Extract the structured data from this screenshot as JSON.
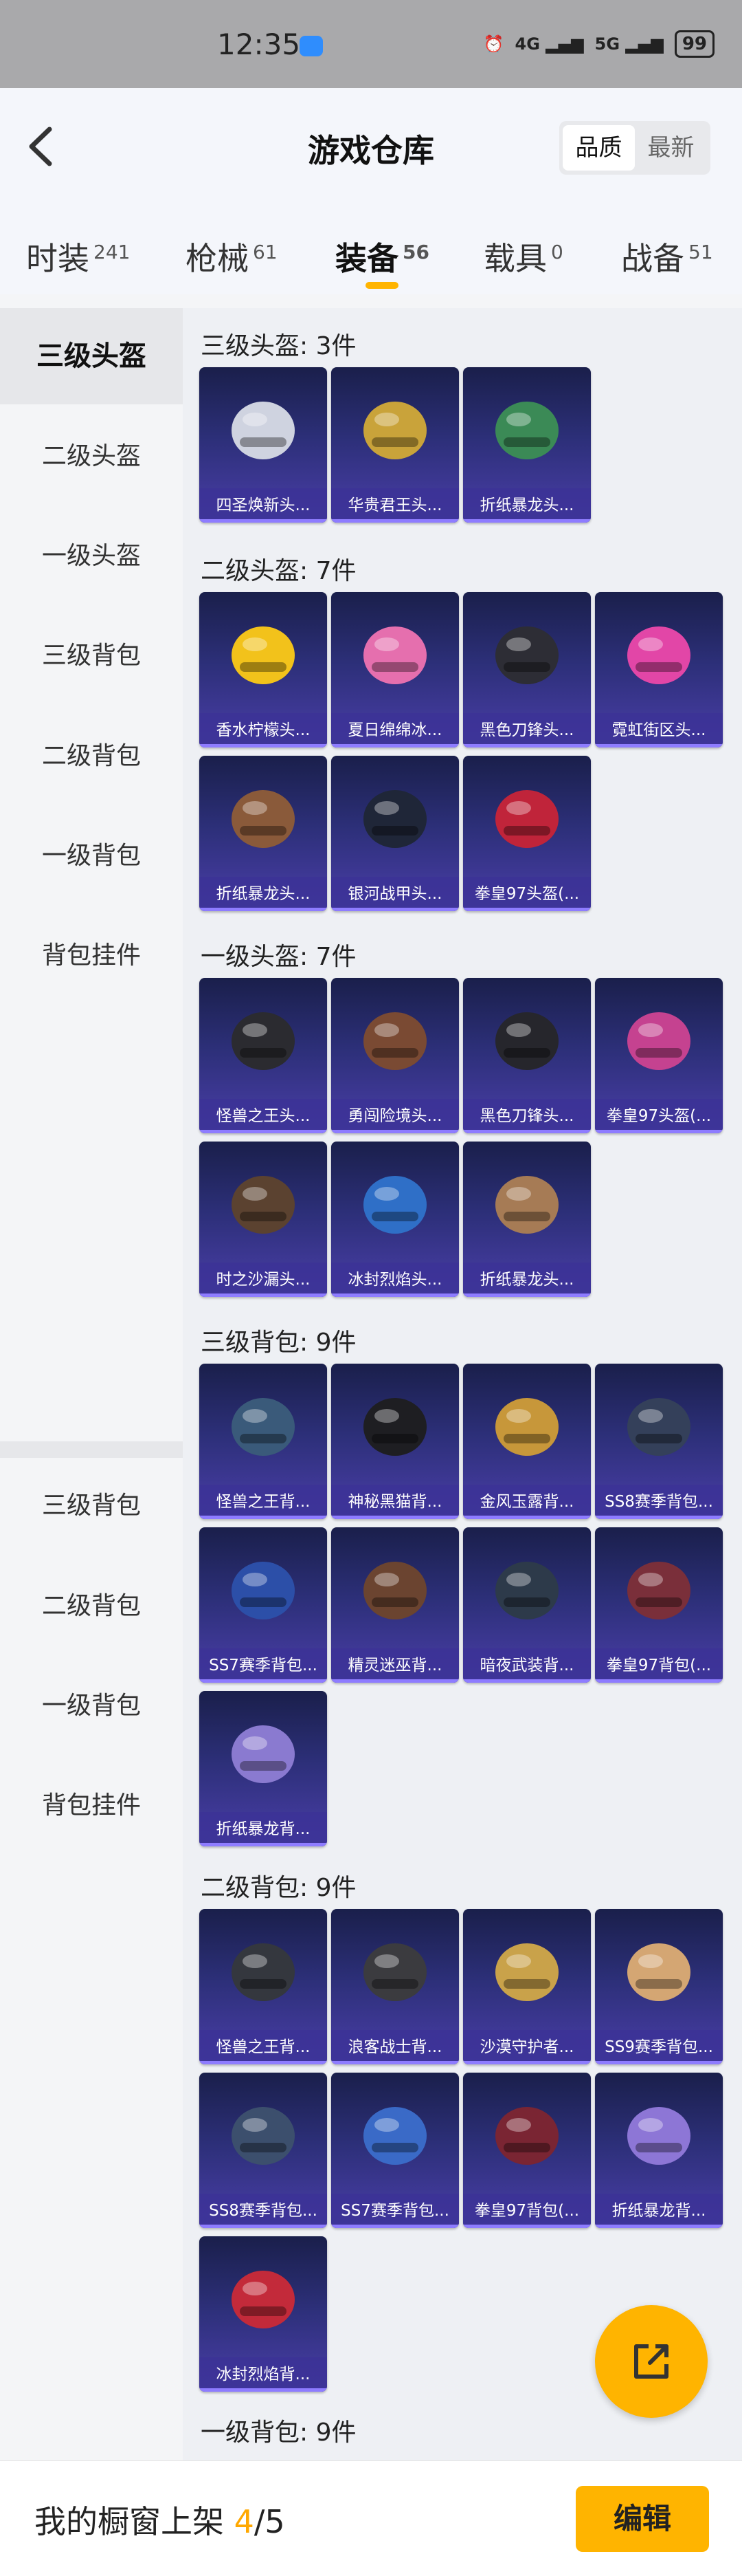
{
  "status": {
    "time": "12:35",
    "network1": "4G",
    "network2": "5G",
    "battery": "99"
  },
  "header": {
    "title": "游戏仓库",
    "sort": [
      "品质",
      "最新"
    ]
  },
  "tabs": [
    {
      "label": "时装",
      "count": "241"
    },
    {
      "label": "枪械",
      "count": "61"
    },
    {
      "label": "装备",
      "count": "56"
    },
    {
      "label": "载具",
      "count": "0"
    },
    {
      "label": "战备",
      "count": "51"
    }
  ],
  "sidebar": [
    "三级头盔",
    "二级头盔",
    "一级头盔",
    "三级背包",
    "二级背包",
    "一级背包",
    "背包挂件",
    "三级背包",
    "二级背包",
    "一级背包",
    "背包挂件"
  ],
  "sections": [
    {
      "title": "三级头盔: 3件",
      "items": [
        {
          "name": "四圣焕新头...",
          "color": "#cfd3e0"
        },
        {
          "name": "华贵君王头...",
          "color": "#c9a33a"
        },
        {
          "name": "折纸暴龙头...",
          "color": "#3b8a56"
        }
      ]
    },
    {
      "title": "二级头盔: 7件",
      "items": [
        {
          "name": "香水柠檬头...",
          "color": "#f2c21b"
        },
        {
          "name": "夏日绵绵冰...",
          "color": "#e56fae"
        },
        {
          "name": "黑色刀锋头...",
          "color": "#2d2d35"
        },
        {
          "name": "霓虹街区头...",
          "color": "#e246a7"
        },
        {
          "name": "折纸暴龙头...",
          "color": "#8a5a3a"
        },
        {
          "name": "银河战甲头...",
          "color": "#1f2638"
        },
        {
          "name": "拳皇97头盔(...",
          "color": "#c0243a"
        }
      ]
    },
    {
      "title": "一级头盔: 7件",
      "items": [
        {
          "name": "怪兽之王头...",
          "color": "#2b2b30"
        },
        {
          "name": "勇闯险境头...",
          "color": "#7a4a33"
        },
        {
          "name": "黑色刀锋头...",
          "color": "#26262c"
        },
        {
          "name": "拳皇97头盔(...",
          "color": "#c54290"
        },
        {
          "name": "时之沙漏头...",
          "color": "#5b4230"
        },
        {
          "name": "冰封烈焰头...",
          "color": "#2f6fc7"
        },
        {
          "name": "折纸暴龙头...",
          "color": "#a67b55"
        }
      ]
    },
    {
      "title": "三级背包: 9件",
      "items": [
        {
          "name": "怪兽之王背...",
          "color": "#3a5a7a"
        },
        {
          "name": "神秘黑猫背...",
          "color": "#1e1e22"
        },
        {
          "name": "金风玉露背...",
          "color": "#c7973a"
        },
        {
          "name": "SS8赛季背包...",
          "color": "#34405a"
        },
        {
          "name": "SS7赛季背包...",
          "color": "#2c4fa8"
        },
        {
          "name": "精灵迷巫背...",
          "color": "#6b4430"
        },
        {
          "name": "暗夜武装背...",
          "color": "#2d3a4a"
        },
        {
          "name": "拳皇97背包(...",
          "color": "#7a2f3a"
        },
        {
          "name": "折纸暴龙背...",
          "color": "#8a7ad0"
        }
      ]
    },
    {
      "title": "二级背包: 9件",
      "items": [
        {
          "name": "怪兽之王背...",
          "color": "#34373e"
        },
        {
          "name": "浪客战士背...",
          "color": "#3b3b3f"
        },
        {
          "name": "沙漠守护者...",
          "color": "#c9a24a"
        },
        {
          "name": "SS9赛季背包...",
          "color": "#d4a673"
        },
        {
          "name": "SS8赛季背包...",
          "color": "#3c4f6d"
        },
        {
          "name": "SS7赛季背包...",
          "color": "#3a6ac7"
        },
        {
          "name": "拳皇97背包(...",
          "color": "#7a2533"
        },
        {
          "name": "折纸暴龙背...",
          "color": "#8d76d6"
        },
        {
          "name": "冰封烈焰背...",
          "color": "#c32a3a"
        }
      ]
    },
    {
      "title": "一级背包: 9件",
      "items": []
    }
  ],
  "bottom": {
    "shelf_prefix": "我的橱窗上架",
    "shelf_count": "4",
    "shelf_total": "/5",
    "edit": "编辑"
  }
}
